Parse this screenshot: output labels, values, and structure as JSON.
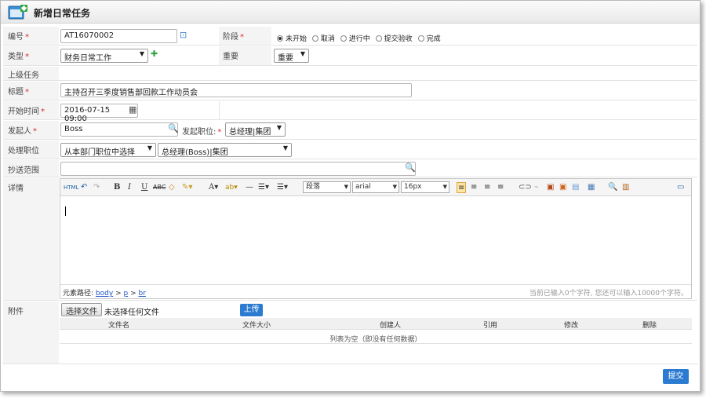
{
  "window": {
    "title": "新增日常任务"
  },
  "labels": {
    "code": "编号",
    "stage": "阶段",
    "type": "类型",
    "importance": "重要",
    "parent": "上级任务",
    "title": "标题",
    "start": "开始时间",
    "initiator": "发起人",
    "initiator_pos": "发起职位:",
    "handler_pos": "处理职位",
    "cc": "抄送范围",
    "detail": "详情",
    "attach": "附件",
    "required_mark": "*"
  },
  "fields": {
    "code_value": "AT16070002",
    "type_value": "财务日常工作",
    "importance_value": "重要",
    "title_value": "主持召开三季度销售部回款工作动员会",
    "start_value": "2016-07-15 09:00",
    "initiator_value": "Boss",
    "initiator_pos_value": "总经理|集团",
    "handler_dept_value": "从本部门职位中选择",
    "handler_pos_value": "总经理(Boss)|集团",
    "cc_value": ""
  },
  "stage_options": [
    {
      "label": "未开始",
      "selected": true
    },
    {
      "label": "取消",
      "selected": false
    },
    {
      "label": "进行中",
      "selected": false
    },
    {
      "label": "提交验收",
      "selected": false
    },
    {
      "label": "完成",
      "selected": false
    }
  ],
  "editor": {
    "paragraph_select": "段落",
    "font_select": "arial",
    "size_select": "16px",
    "path_label": "元素路径:",
    "path_items": [
      "body",
      "p",
      "br"
    ],
    "path_sep": ">",
    "count_text": "当前已输入0个字符, 您还可以输入10000个字符。"
  },
  "attachments": {
    "choose_button": "选择文件",
    "no_file_text": "未选择任何文件",
    "upload_button": "上传",
    "columns": [
      "文件名",
      "文件大小",
      "创建人",
      "引用",
      "修改",
      "删除"
    ],
    "empty_text": "列表为空（即没有任何数据）"
  },
  "submit_label": "提交",
  "colors": {
    "accent": "#2b7bd0",
    "required": "#e0262c",
    "label_bg": "#f4f4f4"
  }
}
